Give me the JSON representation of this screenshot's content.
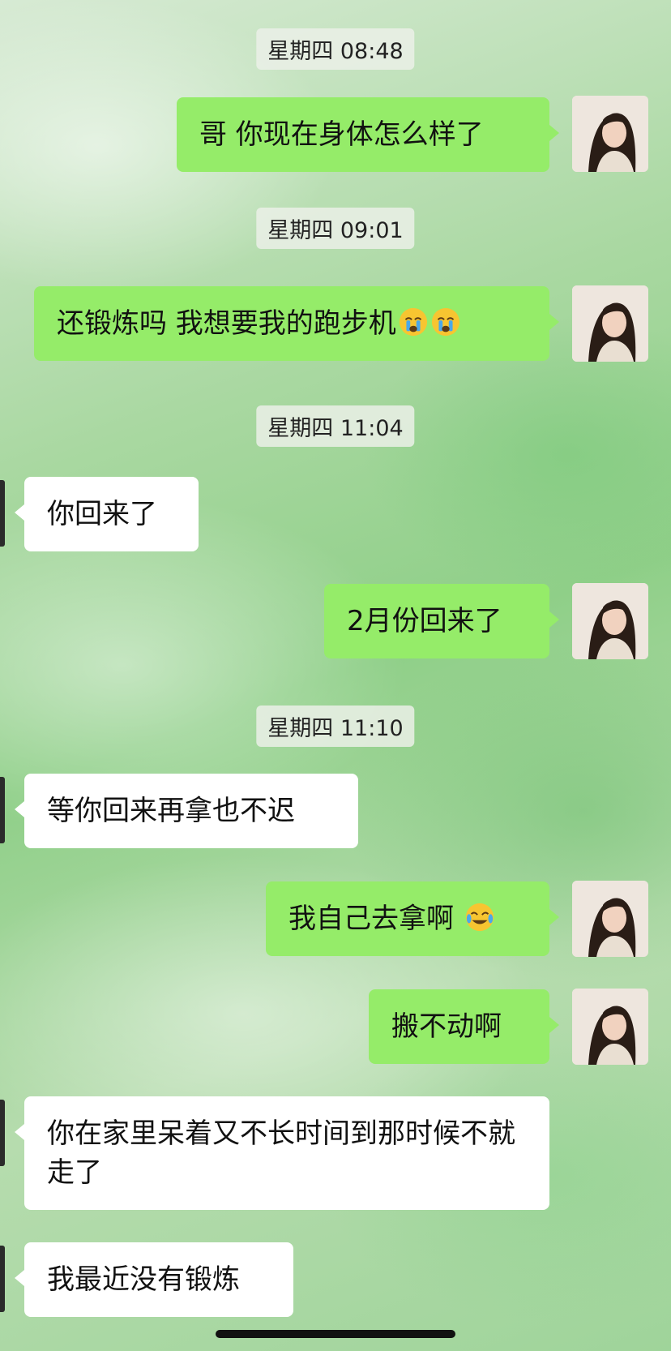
{
  "chat": {
    "timestamps": [
      "星期四 08:48",
      "星期四 09:01",
      "星期四 11:04",
      "星期四 11:10"
    ],
    "messages": [
      {
        "side": "out",
        "text": "哥 你现在身体怎么样了"
      },
      {
        "side": "out",
        "text": "还锻炼吗 我想要我的跑步机",
        "emojis": [
          "crying-face",
          "crying-face"
        ]
      },
      {
        "side": "in",
        "text": "你回来了"
      },
      {
        "side": "out",
        "text": "2月份回来了"
      },
      {
        "side": "in",
        "text": "等你回来再拿也不迟"
      },
      {
        "side": "out",
        "text": "我自己去拿啊 ",
        "emojis": [
          "tears-of-joy-face"
        ]
      },
      {
        "side": "out",
        "text": "搬不动啊"
      },
      {
        "side": "in",
        "text": "你在家里呆着又不长时间到那时候不就走了"
      },
      {
        "side": "in",
        "text": "我最近没有锻炼"
      }
    ]
  },
  "colors": {
    "outgoing_bubble": "#95ec69",
    "incoming_bubble": "#ffffff"
  }
}
